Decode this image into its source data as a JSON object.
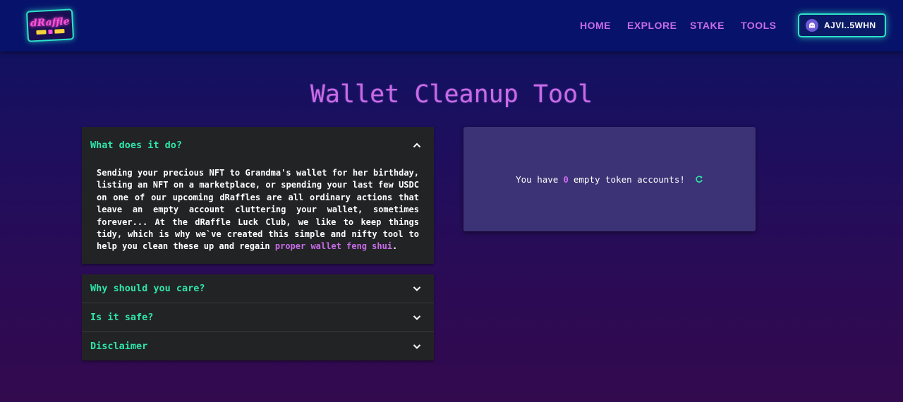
{
  "brand": {
    "logo_icon": "draffle-luck-club-logo"
  },
  "nav": {
    "items": [
      {
        "label": "HOME"
      },
      {
        "label": "EXPLORE"
      },
      {
        "label": "STAKE"
      },
      {
        "label": "TOOLS"
      }
    ]
  },
  "wallet": {
    "label": "AJVI..5WHN",
    "icon": "ghost-avatar-icon"
  },
  "page": {
    "title": "Wallet Cleanup Tool"
  },
  "accordion": {
    "items": [
      {
        "title": "What does it do?",
        "expanded": true,
        "body": "Sending your precious NFT to Grandma's wallet for her birthday, listing an NFT on a marketplace, or spending your last few USDC on one of our upcoming dRaffles are all ordinary actions that leave an empty account cluttering your wallet, sometimes forever... At the dRaffle Luck Club, we like to keep things tidy, which is why we`ve created this simple and nifty tool to help you clean these up and regain ",
        "link": "proper wallet feng shui",
        "body_end": "."
      },
      {
        "title": "Why should you care?",
        "expanded": false
      },
      {
        "title": "Is it safe?",
        "expanded": false
      },
      {
        "title": "Disclaimer",
        "expanded": false
      }
    ]
  },
  "status": {
    "prefix": "You have",
    "count": "0",
    "suffix": "empty token accounts!",
    "refresh_icon": "refresh-icon"
  },
  "colors": {
    "accent_purple": "#c86be8",
    "accent_green": "#2ee6a6",
    "accent_teal": "#2de2c8",
    "header_bg": "#07136a",
    "card_bg": "#3b3375",
    "panel_bg": "#222325"
  }
}
